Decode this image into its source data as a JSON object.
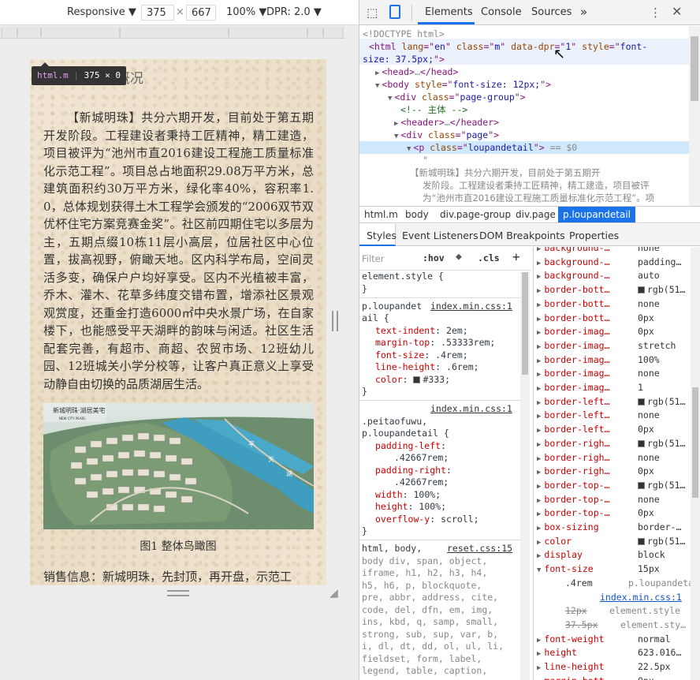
{
  "device_toolbar": {
    "mode": "Responsive",
    "width": "375",
    "times": "×",
    "height": "667",
    "zoom": "100%",
    "dpr": "DPR: 2.0"
  },
  "page": {
    "title_fragment": "概况",
    "paragraph": "【新城明珠】共分六期开发，目前处于第五期开发阶段。工程建设者秉持工匠精神，精工建造，项目被评为“池州市直2016建设工程施工质量标准化示范工程”。项目总占地面积29.08万平方米，总建筑面积约30万平方米，绿化率40%，容积率1.0，总体规划获得土木工程学会颁发的“2006双节双优杯住宅方案竞赛金奖”。社区前四期住宅以多层为主，五期点缀10栋11层小高层，位居社区中心位置，拔高视野，俯瞰天地。区内科学布局，空间灵活多变，确保户户均好享受。区内不光植被丰富，乔木、灌木、花草多纬度交错布置，增添社区景观观赏度，还重金打造6000㎡中央水景广场，在自家楼下，也能感受平天湖畔的韵味与闲适。社区生活配套完善，有超市、商超、农贸市场、12班幼儿园、12班城关小学分校等，让客户真正意义上享受动静自由切换的品质湖居生活。",
    "image_logo": "新城明珠·湖居美宅",
    "image_logo_sub": "NEW CITY PEARL",
    "image_labels": [
      "平",
      "天",
      "湖"
    ],
    "caption": "图1 整体鸟瞰图",
    "sale_info": "销售信息：新城明珠，先封顶，再开盘，示范工"
  },
  "tooltip": {
    "tag": "html.m",
    "size": "375 × 0"
  },
  "devtools": {
    "tabs": [
      "Elements",
      "Console",
      "Sources",
      "»"
    ],
    "dom_lines": [
      {
        "parts": [
          [
            "gr",
            "<!DOCTYPE html>"
          ]
        ]
      },
      {
        "parts": [
          [
            "tg",
            "<html "
          ],
          [
            "an",
            "lang"
          ],
          [
            "tg",
            "=\""
          ],
          [
            "av",
            "en"
          ],
          [
            "tg",
            "\" "
          ],
          [
            "an",
            "class"
          ],
          [
            "tg",
            "=\""
          ],
          [
            "av",
            "m"
          ],
          [
            "tg",
            "\" "
          ],
          [
            "an",
            "data-dpr"
          ],
          [
            "tg",
            "=\""
          ],
          [
            "av",
            "1"
          ],
          [
            "tg",
            "\" "
          ],
          [
            "an",
            "style"
          ],
          [
            "tg",
            "=\""
          ],
          [
            "av",
            "font-"
          ]
        ]
      },
      {
        "parts": [
          [
            "av",
            "size: 37.5px;"
          ],
          [
            "tg",
            "\">"
          ]
        ]
      },
      {
        "parts": [
          [
            "tg",
            "<head>"
          ],
          [
            "gr",
            "…"
          ],
          [
            "tg",
            "</head>"
          ]
        ]
      },
      {
        "parts": [
          [
            "tg",
            "<body "
          ],
          [
            "an",
            "style"
          ],
          [
            "tg",
            "=\""
          ],
          [
            "av",
            "font-size: 12px;"
          ],
          [
            "tg",
            "\">"
          ]
        ]
      },
      {
        "parts": [
          [
            "tg",
            "<div "
          ],
          [
            "an",
            "class"
          ],
          [
            "tg",
            "=\""
          ],
          [
            "av",
            "page-group"
          ],
          [
            "tg",
            "\">"
          ]
        ]
      },
      {
        "parts": [
          [
            "cm",
            "<!-- 主体 -->"
          ]
        ]
      },
      {
        "parts": [
          [
            "tg",
            "<header>"
          ],
          [
            "gr",
            "…"
          ],
          [
            "tg",
            "</header>"
          ]
        ]
      },
      {
        "parts": [
          [
            "tg",
            "<div "
          ],
          [
            "an",
            "class"
          ],
          [
            "tg",
            "=\""
          ],
          [
            "av",
            "page"
          ],
          [
            "tg",
            "\">"
          ]
        ]
      },
      {
        "parts": [
          [
            "tg",
            "<p "
          ],
          [
            "an",
            "class"
          ],
          [
            "tg",
            "=\""
          ],
          [
            "av",
            "loupandetail"
          ],
          [
            "tg",
            "\">"
          ],
          [
            "gr",
            " == $0"
          ]
        ]
      },
      {
        "parts": [
          [
            "gr",
            "\""
          ]
        ]
      },
      {
        "parts": [
          [
            "gr",
            "        【新城明珠】共分六期开发，目前处于第五期开"
          ]
        ]
      },
      {
        "parts": [
          [
            "gr",
            "发阶段。工程建设者秉持工匠精神，精工建造，项目被评"
          ]
        ]
      },
      {
        "parts": [
          [
            "gr",
            "为“池州市直2016建设工程施工质量标准化示范工程”。项"
          ]
        ]
      }
    ],
    "breadcrumbs": [
      "html.m",
      "body",
      "div.page-group",
      "div.page",
      "p.loupandetail"
    ],
    "style_tabs": [
      "Styles",
      "Event Listeners",
      "DOM Breakpoints",
      "Properties"
    ],
    "filter": {
      "placeholder": "Filter",
      "hov": ":hov",
      "cls": ".cls",
      "plus": "+"
    },
    "rules": [
      {
        "type": "sel",
        "text": "element.style {"
      },
      {
        "type": "close",
        "text": "}"
      },
      {
        "type": "sel",
        "text": "p.loupandet",
        "src": "index.min.css:1"
      },
      {
        "type": "sel",
        "text": "ail {"
      },
      {
        "type": "decl",
        "name": "text-indent",
        "value": "2em;"
      },
      {
        "type": "decl",
        "name": "margin-top",
        "value": ".53333rem;"
      },
      {
        "type": "decl",
        "name": "font-size",
        "value": ".4rem;"
      },
      {
        "type": "decl",
        "name": "line-height",
        "value": ".6rem;"
      },
      {
        "type": "decl",
        "name": "color",
        "value": "#333;",
        "swatch": true
      },
      {
        "type": "close",
        "text": "}"
      },
      {
        "type": "src",
        "src": "index.min.css:1"
      },
      {
        "type": "sel",
        "text": ".peitaofuwu,"
      },
      {
        "type": "sel",
        "text": "p.loupandetail {"
      },
      {
        "type": "decl",
        "name": "padding-left",
        "value": ""
      },
      {
        "type": "val",
        "value": ".42667rem;"
      },
      {
        "type": "decl",
        "name": "padding-right",
        "value": ""
      },
      {
        "type": "val",
        "value": ".42667rem;"
      },
      {
        "type": "decl",
        "name": "width",
        "value": "100%;"
      },
      {
        "type": "decl",
        "name": "height",
        "value": "100%;"
      },
      {
        "type": "decl",
        "name": "overflow-y",
        "value": "scroll;"
      },
      {
        "type": "close",
        "text": "}"
      },
      {
        "type": "sel",
        "text": "html, body,",
        "src": "reset.css:15"
      },
      {
        "type": "ua",
        "text": "body div, span, object,"
      },
      {
        "type": "ua",
        "text": "iframe, h1, h2, h3, h4,"
      },
      {
        "type": "ua",
        "text": "h5, h6, p, blockquote,"
      },
      {
        "type": "ua",
        "text": "pre, abbr, address, cite,"
      },
      {
        "type": "ua",
        "text": "code, del, dfn, em, img,"
      },
      {
        "type": "ua",
        "text": "ins, kbd, q, samp, small,"
      },
      {
        "type": "ua",
        "text": "strong, sub, sup, var, b,"
      },
      {
        "type": "ua",
        "text": "i, dl, dt, dd, ol, ul, li,"
      },
      {
        "type": "ua",
        "text": "fieldset, form, label,"
      },
      {
        "type": "ua",
        "text": "legend, table, caption,"
      }
    ],
    "computed": [
      {
        "name": "background-…",
        "value": "none",
        "arrow": "closed",
        "cut": true
      },
      {
        "name": "background-…",
        "value": "padding…",
        "arrow": "closed"
      },
      {
        "name": "background-…",
        "value": "auto",
        "arrow": "closed"
      },
      {
        "name": "border-bott…",
        "value": "rgb(51…",
        "arrow": "closed",
        "swatch": true
      },
      {
        "name": "border-bott…",
        "value": "none",
        "arrow": "closed"
      },
      {
        "name": "border-bott…",
        "value": "0px",
        "arrow": "closed"
      },
      {
        "name": "border-imag…",
        "value": "0px",
        "arrow": "closed"
      },
      {
        "name": "border-imag…",
        "value": "stretch",
        "arrow": "closed"
      },
      {
        "name": "border-imag…",
        "value": "100%",
        "arrow": "closed"
      },
      {
        "name": "border-imag…",
        "value": "none",
        "arrow": "closed"
      },
      {
        "name": "border-imag…",
        "value": "1",
        "arrow": "closed"
      },
      {
        "name": "border-left…",
        "value": "rgb(51…",
        "arrow": "closed",
        "swatch": true
      },
      {
        "name": "border-left…",
        "value": "none",
        "arrow": "closed"
      },
      {
        "name": "border-left…",
        "value": "0px",
        "arrow": "closed"
      },
      {
        "name": "border-righ…",
        "value": "rgb(51…",
        "arrow": "closed",
        "swatch": true
      },
      {
        "name": "border-righ…",
        "value": "none",
        "arrow": "closed"
      },
      {
        "name": "border-righ…",
        "value": "0px",
        "arrow": "closed"
      },
      {
        "name": "border-top-…",
        "value": "rgb(51…",
        "arrow": "closed",
        "swatch": true
      },
      {
        "name": "border-top-…",
        "value": "none",
        "arrow": "closed"
      },
      {
        "name": "border-top-…",
        "value": "0px",
        "arrow": "closed"
      },
      {
        "name": "box-sizing",
        "value": "border-…",
        "arrow": "closed"
      },
      {
        "name": "color",
        "value": "rgb(51…",
        "arrow": "closed",
        "swatch": true
      },
      {
        "name": "display",
        "value": "block",
        "arrow": "closed"
      },
      {
        "name": "font-size",
        "value": "15px",
        "arrow": "open"
      },
      {
        "sub": ".4rem",
        "subval": "p.loupandeta…"
      },
      {
        "subsrc": "index.min.css:1"
      },
      {
        "strike": "12px",
        "subval": "element.style"
      },
      {
        "strike": "37.5px",
        "subval": "element.sty…"
      },
      {
        "name": "font-weight",
        "value": "normal",
        "arrow": "closed"
      },
      {
        "name": "height",
        "value": "623.016…",
        "arrow": "closed"
      },
      {
        "name": "line-height",
        "value": "22.5px",
        "arrow": "closed"
      },
      {
        "name": "margin-bott…",
        "value": "0px",
        "arrow": "closed"
      }
    ]
  }
}
